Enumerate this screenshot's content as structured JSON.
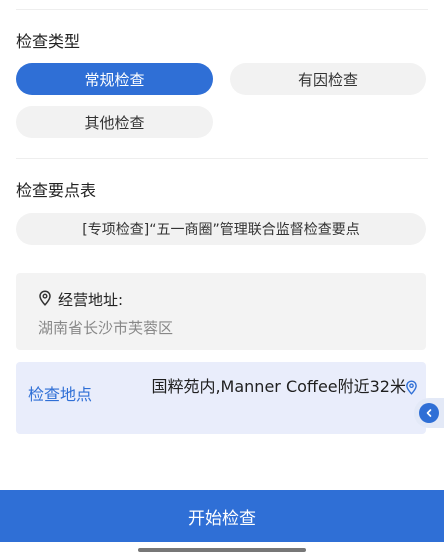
{
  "inspection_type": {
    "title": "检查类型",
    "options": [
      "常规检查",
      "有因检查",
      "其他检查"
    ],
    "selected": "常规检查"
  },
  "checklist": {
    "title": "检查要点表",
    "value": "[专项检查]“五一商圈”管理联合监督检查要点"
  },
  "business_address": {
    "label": "经营地址:",
    "value": "湖南省长沙市芙蓉区"
  },
  "inspection_location": {
    "label": "检查地点",
    "value": "国粹苑内,Manner Coffee附近32米"
  },
  "footer": {
    "start_button": "开始检查"
  },
  "colors": {
    "accent": "#2f6fd6",
    "chip_bg": "#f2f2f2",
    "location_bg": "#e9edfb"
  },
  "icons": {
    "address": "location-pin-icon",
    "location": "location-pin-icon",
    "side_tab": "chevron-left-icon"
  }
}
